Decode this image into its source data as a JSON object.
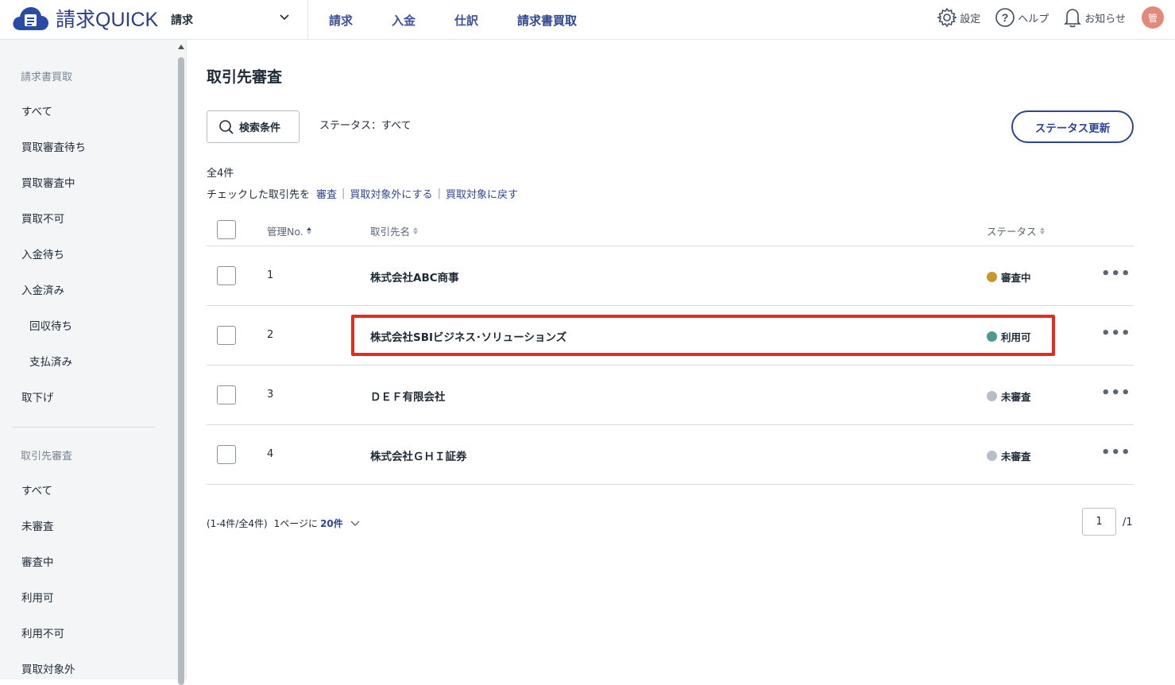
{
  "app": {
    "logo_text": "請求QUICK",
    "service": "請求"
  },
  "topnav": [
    "請求",
    "入金",
    "仕訳",
    "請求書買取"
  ],
  "topright": {
    "settings": "設定",
    "help": "ヘルプ",
    "notice": "お知らせ",
    "avatar": "管"
  },
  "sidebar": {
    "section1": "請求書買取",
    "items1": [
      "すべて",
      "買取審査待ち",
      "買取審査中",
      "買取不可",
      "入金待ち",
      "入金済み",
      "回収待ち",
      "支払済み",
      "取下げ"
    ],
    "section2": "取引先審査",
    "items2": [
      "すべて",
      "未審査",
      "審査中",
      "利用可",
      "利用不可",
      "買取対象外"
    ]
  },
  "main": {
    "title": "取引先審査",
    "search_label": "検索条件",
    "status_filter": "ステータス：すべて",
    "update_label": "ステータス更新",
    "count": "全4件",
    "bulk_prefix": "チェックした取引先を",
    "bulk_actions": [
      "審査",
      "買取対象外にする",
      "買取対象に戻す"
    ]
  },
  "table": {
    "headers": {
      "no": "管理No.",
      "name": "取引先名",
      "status": "ステータス"
    },
    "rows": [
      {
        "no": "1",
        "name": "株式会社ABC商事",
        "status": "審査中",
        "color": "#c9962a"
      },
      {
        "no": "2",
        "name": "株式会社SBIビジネス･ソリューションズ",
        "status": "利用可",
        "color": "#4e9a8f"
      },
      {
        "no": "3",
        "name": "ＤＥＦ有限会社",
        "status": "未審査",
        "color": "#b8bec7"
      },
      {
        "no": "4",
        "name": "株式会社ＧＨＩ証券",
        "status": "未審査",
        "color": "#b8bec7"
      }
    ],
    "more": "•••"
  },
  "pager": {
    "info": "(1-4件/全4件)",
    "per_prefix": "1ページに",
    "per_value": "20件",
    "current": "1",
    "total": "/1"
  }
}
